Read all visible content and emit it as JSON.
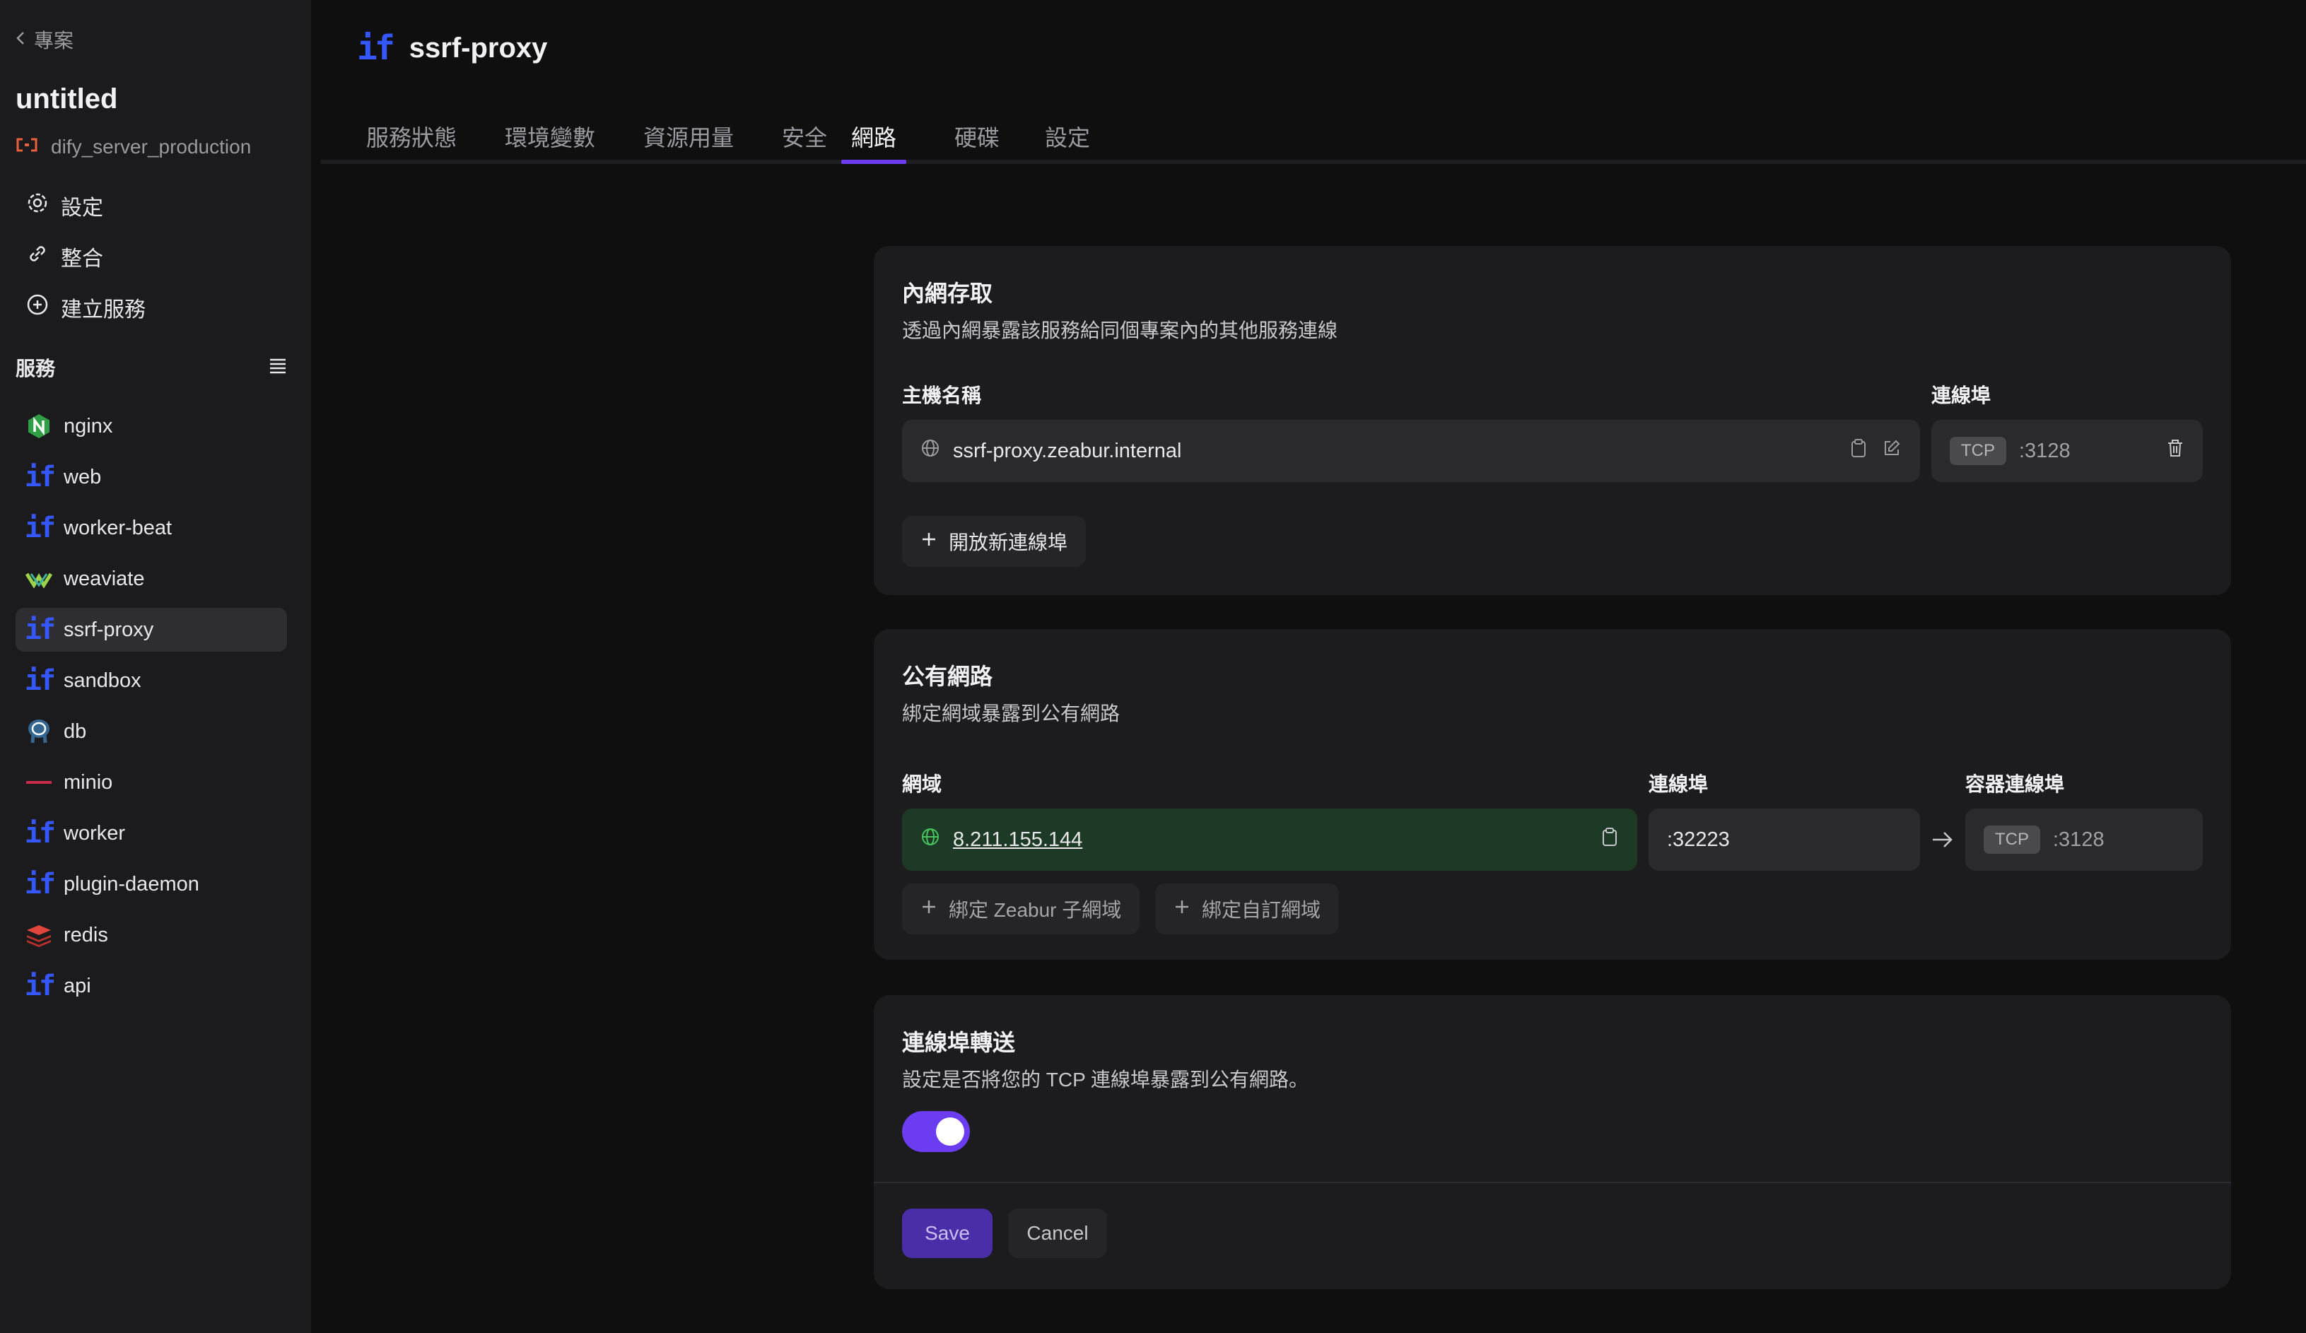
{
  "sidebar": {
    "back_label": "專案",
    "project_title": "untitled",
    "environment": "dify_server_production",
    "menu": [
      {
        "label": "設定",
        "icon": "gear-icon"
      },
      {
        "label": "整合",
        "icon": "link-icon"
      },
      {
        "label": "建立服務",
        "icon": "plus-circle-icon"
      }
    ],
    "services_label": "服務",
    "services": [
      {
        "name": "nginx",
        "icon": "nginx-icon"
      },
      {
        "name": "web",
        "icon": "dify-icon"
      },
      {
        "name": "worker-beat",
        "icon": "dify-icon"
      },
      {
        "name": "weaviate",
        "icon": "weaviate-icon"
      },
      {
        "name": "ssrf-proxy",
        "icon": "dify-icon",
        "active": true
      },
      {
        "name": "sandbox",
        "icon": "dify-icon"
      },
      {
        "name": "db",
        "icon": "postgres-icon"
      },
      {
        "name": "minio",
        "icon": "minio-icon"
      },
      {
        "name": "worker",
        "icon": "dify-icon"
      },
      {
        "name": "plugin-daemon",
        "icon": "dify-icon"
      },
      {
        "name": "redis",
        "icon": "redis-icon"
      },
      {
        "name": "api",
        "icon": "dify-icon"
      }
    ]
  },
  "header": {
    "logo_text": "if",
    "title": "ssrf-proxy"
  },
  "tabs": [
    {
      "label": "服務狀態"
    },
    {
      "label": "環境變數"
    },
    {
      "label": "資源用量"
    },
    {
      "label": "安全"
    },
    {
      "label": "網路",
      "active": true
    },
    {
      "label": "硬碟"
    },
    {
      "label": "設定"
    }
  ],
  "private_network": {
    "title": "內網存取",
    "subtitle": "透過內網暴露該服務給同個專案內的其他服務連線",
    "hostname_label": "主機名稱",
    "hostname": "ssrf-proxy.zeabur.internal",
    "port_label": "連線埠",
    "protocol": "TCP",
    "port": ":3128",
    "add_port_label": "開放新連線埠"
  },
  "public_network": {
    "title": "公有網路",
    "subtitle": "綁定網域暴露到公有網路",
    "domain_label": "網域",
    "domain": "8.211.155.144",
    "port_label": "連線埠",
    "port": ":32223",
    "container_port_label": "容器連線埠",
    "protocol": "TCP",
    "container_port": ":3128",
    "bind_zeabur_label": "綁定 Zeabur 子網域",
    "bind_custom_label": "綁定自訂網域"
  },
  "port_forwarding": {
    "title": "連線埠轉送",
    "subtitle": "設定是否將您的 TCP 連線埠暴露到公有網路。",
    "enabled": true,
    "save_label": "Save",
    "cancel_label": "Cancel"
  },
  "colors": {
    "accent": "#6c3cf0",
    "dify_blue": "#3457ff",
    "domain_bg": "#1d3a26"
  }
}
